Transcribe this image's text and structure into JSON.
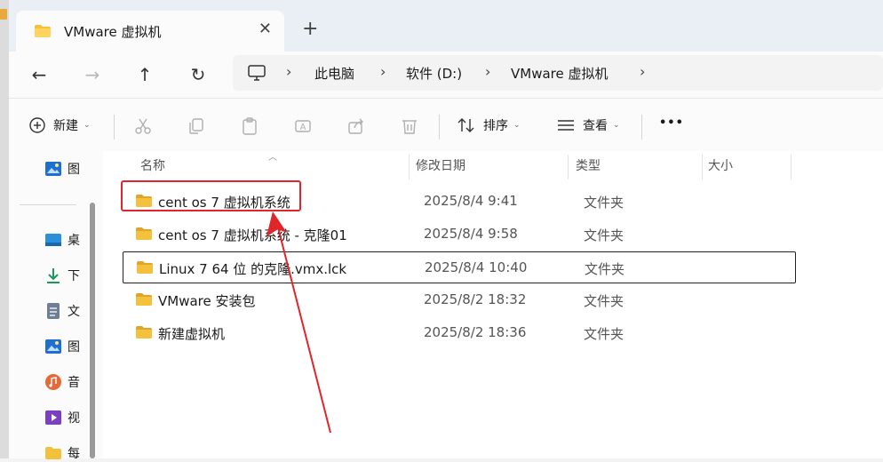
{
  "window": {
    "tab_title": "VMware 虚拟机",
    "new_tab_symbol": "+",
    "close_symbol": "✕"
  },
  "nav": {
    "back": "←",
    "forward": "→",
    "up": "↑",
    "refresh": "↻"
  },
  "breadcrumb": {
    "items": [
      "此电脑",
      "软件 (D:)",
      "VMware 虚拟机"
    ],
    "separator": "›"
  },
  "toolbar": {
    "new_label": "新建",
    "sort_label": "排序",
    "view_label": "查看",
    "more_label": "•••",
    "caret": "⌄"
  },
  "sidebar": {
    "items": [
      {
        "label": "图",
        "icon": "pictures-icon"
      },
      {
        "label": "桌",
        "icon": "desktop-icon"
      },
      {
        "label": "下",
        "icon": "download-icon"
      },
      {
        "label": "文",
        "icon": "documents-icon"
      },
      {
        "label": "图",
        "icon": "pictures-icon"
      },
      {
        "label": "音",
        "icon": "music-icon"
      },
      {
        "label": "视",
        "icon": "videos-icon"
      },
      {
        "label": "每",
        "icon": "folder-icon"
      }
    ]
  },
  "columns": {
    "name": "名称",
    "date": "修改日期",
    "type": "类型",
    "size": "大小"
  },
  "files": [
    {
      "name": "cent os 7 虚拟机系统",
      "date": "2025/8/4 9:41",
      "type": "文件夹"
    },
    {
      "name": "cent os 7 虚拟机系统 - 克隆01",
      "date": "2025/8/4 9:58",
      "type": "文件夹"
    },
    {
      "name": "Linux 7 64 位 的克隆.vmx.lck",
      "date": "2025/8/4 10:40",
      "type": "文件夹"
    },
    {
      "name": "VMware 安装包",
      "date": "2025/8/2 18:32",
      "type": "文件夹"
    },
    {
      "name": "新建虚拟机",
      "date": "2025/8/2 18:36",
      "type": "文件夹"
    }
  ],
  "colors": {
    "accent_red": "#e0262a",
    "folder_yellow": "#f4c13d",
    "folder_dark": "#e0a52a"
  }
}
